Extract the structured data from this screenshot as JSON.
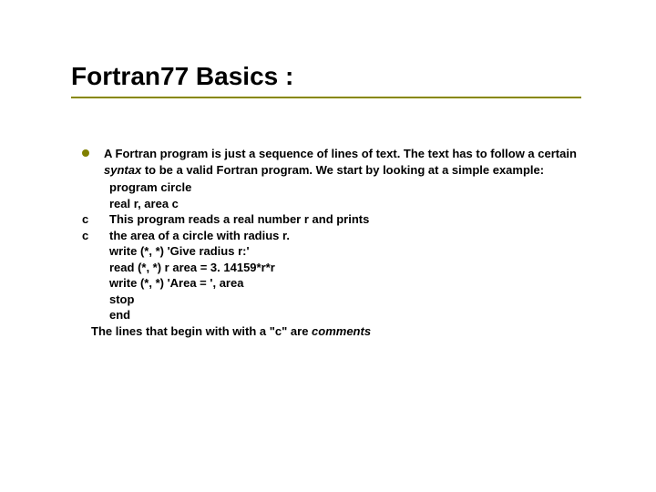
{
  "title": "Fortran77 Basics :",
  "intro_pre": "A Fortran program is just a sequence of lines of text. The text has to follow a certain ",
  "intro_syntax": "syntax",
  "intro_post": " to be a valid Fortran program. We start by looking at a simple example:",
  "code": {
    "l1": "program circle",
    "l2": "real r, area c",
    "c1_c": "c",
    "c1_text": "This program reads a real number r and prints",
    "c2_c": "c",
    "c2_text": "the area of a circle with radius r.",
    "l3": "write (*, *) 'Give radius r:'",
    "l4": "read (*, *) r area = 3. 14159*r*r",
    "l5": "write (*, *) 'Area = ', area",
    "l6": "stop",
    "l7": "end"
  },
  "closing_pre": "The lines that begin with with a \"c\" are ",
  "closing_em": "comments"
}
